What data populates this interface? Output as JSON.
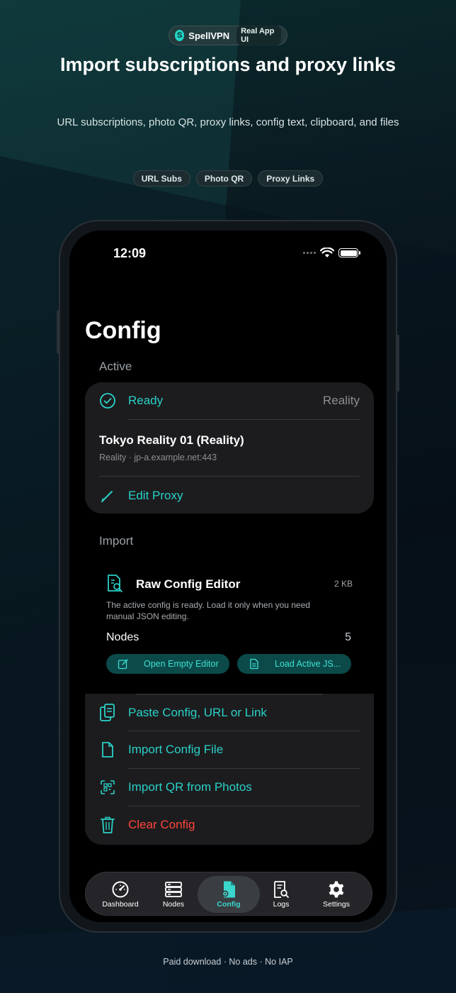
{
  "promo": {
    "brand_name": "SpellVPN",
    "brand_initial": "S",
    "brand_tag": "Real App UI",
    "headline": "Import subscriptions and proxy links",
    "subline": "URL subscriptions, photo QR, proxy links, config text, clipboard, and files",
    "chips": [
      "URL Subs",
      "Photo QR",
      "Proxy Links"
    ],
    "footer": "Paid download · No ads · No IAP"
  },
  "status_bar": {
    "time": "12:09"
  },
  "page": {
    "title": "Config"
  },
  "active": {
    "section_label": "Active",
    "status_label": "Ready",
    "status_type": "Reality",
    "proxy_name": "Tokyo Reality 01 (Reality)",
    "proxy_detail": "Reality · jp-a.example.net:443",
    "edit_label": "Edit Proxy"
  },
  "import": {
    "section_label": "Import",
    "raw_editor": {
      "title": "Raw Config Editor",
      "size": "2 KB",
      "description": "The active config is ready. Load it only when you need manual JSON editing.",
      "nodes_label": "Nodes",
      "nodes_count": "5",
      "open_empty_label": "Open Empty Editor",
      "load_active_label": "Load Active JS..."
    },
    "actions": {
      "paste": "Paste Config, URL or Link",
      "file": "Import Config File",
      "qr": "Import QR from Photos",
      "clear": "Clear Config"
    }
  },
  "tabbar": {
    "tabs": [
      "Dashboard",
      "Nodes",
      "Config",
      "Logs",
      "Settings"
    ],
    "active_index": 2
  },
  "colors": {
    "accent": "#2ad1c8",
    "danger": "#ff453a",
    "card": "#1c1c1e"
  }
}
